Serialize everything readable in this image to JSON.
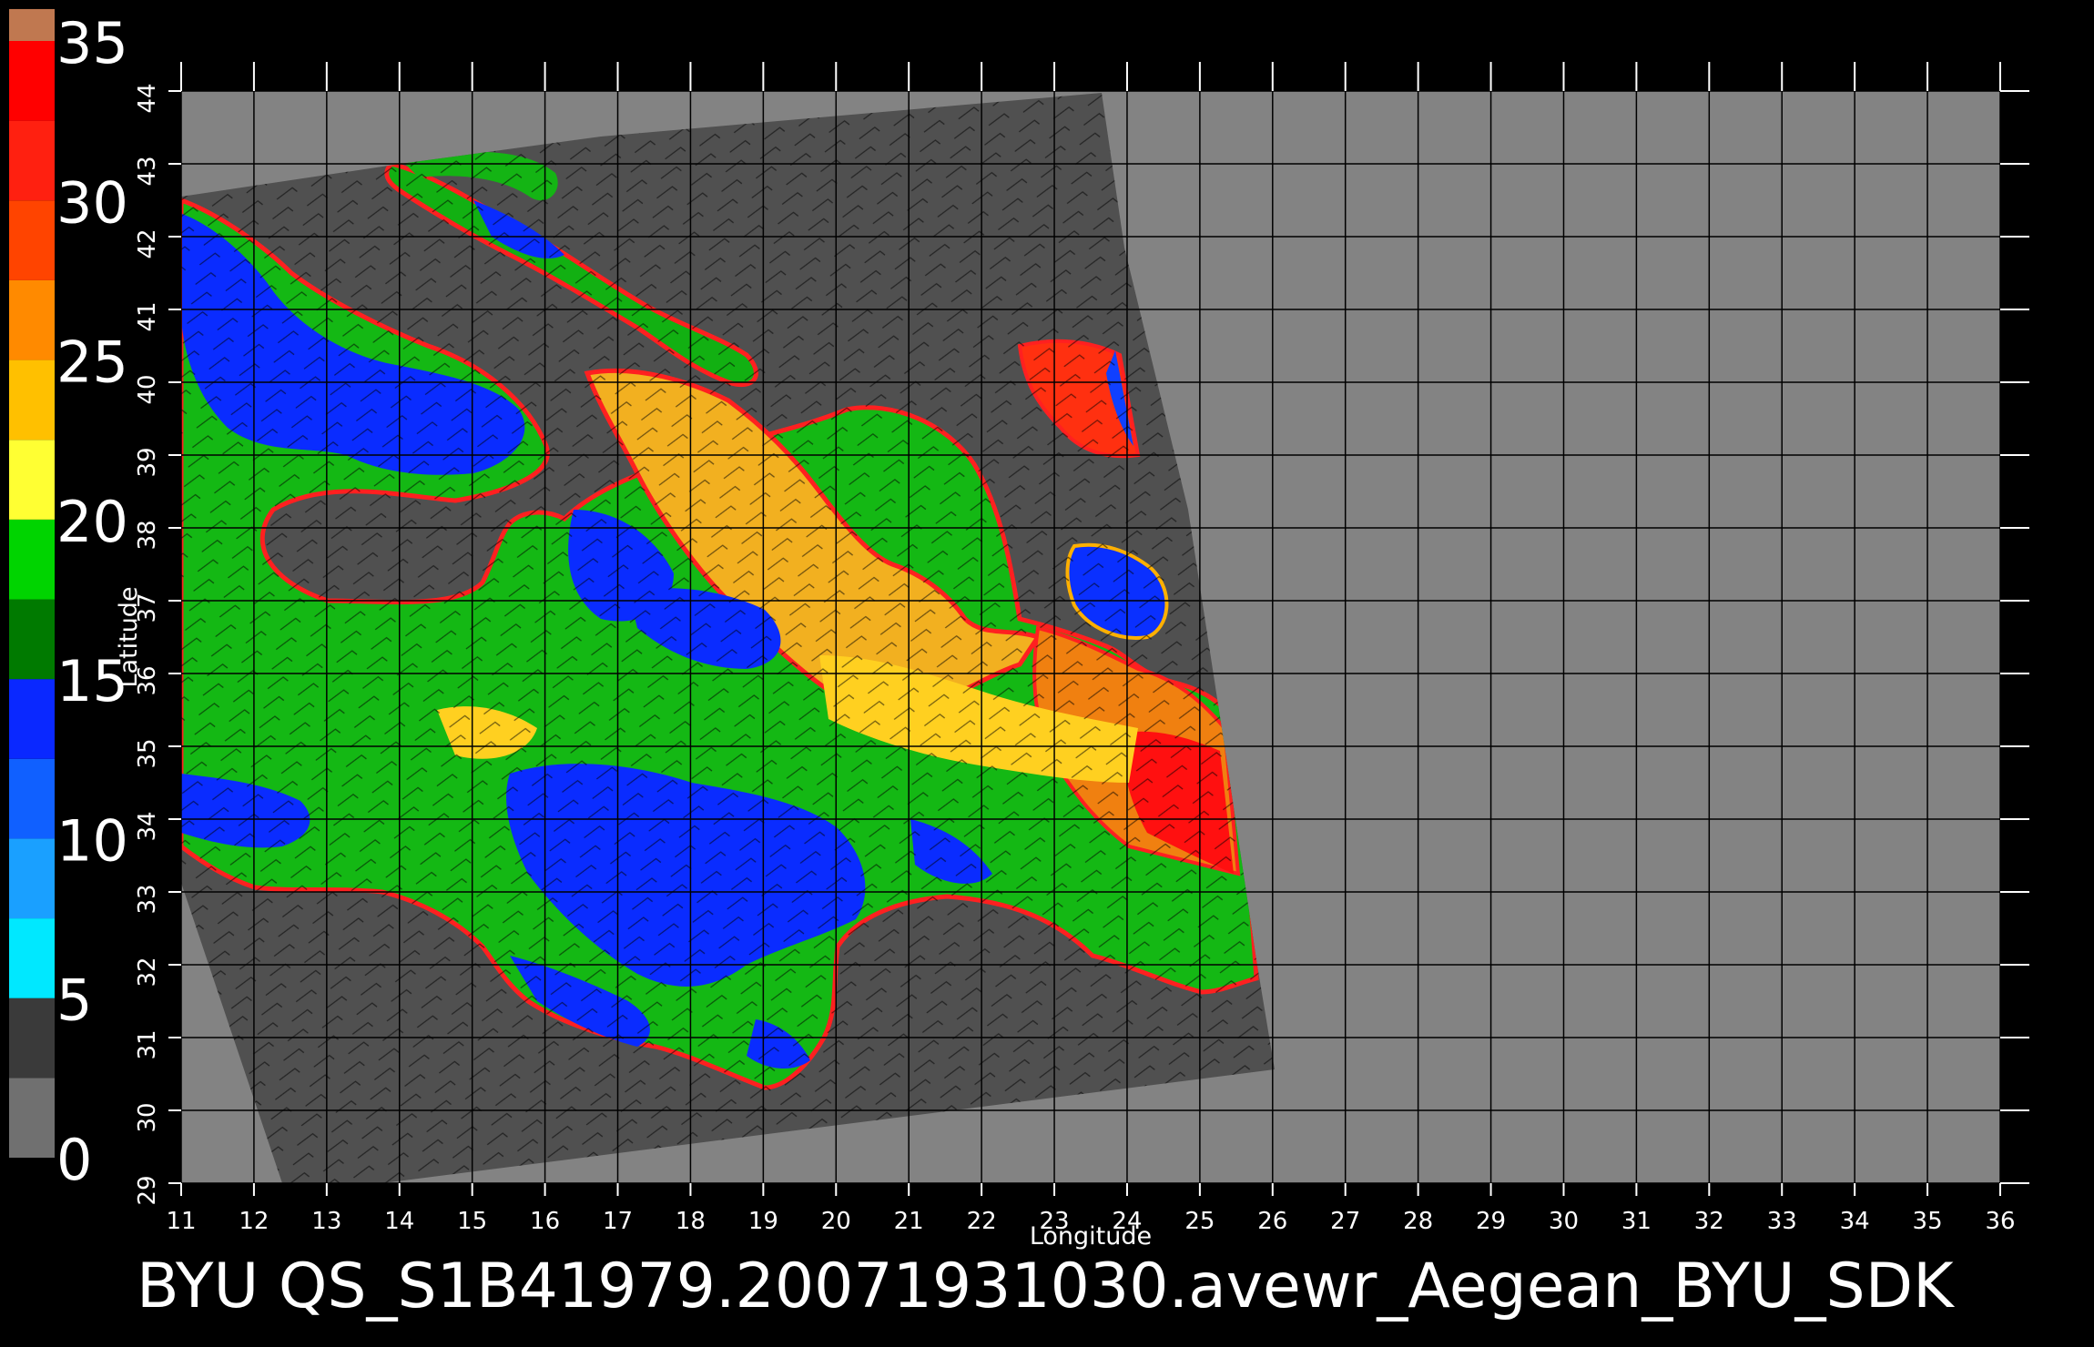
{
  "title": "BYU  QS_S1B41979.20071931030.avewr_Aegean_BYU_SDK",
  "axes": {
    "xlabel": "Longitude",
    "ylabel": "Latitude",
    "x_range": [
      11,
      36
    ],
    "y_range": [
      29,
      44
    ],
    "x_ticks": [
      "11",
      "12",
      "13",
      "14",
      "15",
      "16",
      "17",
      "18",
      "19",
      "20",
      "21",
      "22",
      "23",
      "24",
      "25",
      "26",
      "27",
      "28",
      "29",
      "30",
      "31",
      "32",
      "33",
      "34",
      "35",
      "36"
    ],
    "y_ticks": [
      "29",
      "30",
      "31",
      "32",
      "33",
      "34",
      "35",
      "36",
      "37",
      "38",
      "39",
      "40",
      "41",
      "42",
      "43",
      "44"
    ],
    "grid": true
  },
  "colorbar": {
    "range": [
      0,
      35
    ],
    "labels": [
      "35",
      "30",
      "25",
      "20",
      "15",
      "10",
      "5",
      "0"
    ],
    "label_values": [
      35,
      30,
      25,
      20,
      15,
      10,
      5,
      0
    ],
    "bands": [
      {
        "from": 0,
        "to": 2.5,
        "color": "#707070"
      },
      {
        "from": 2.5,
        "to": 5,
        "color": "#3a3a3a"
      },
      {
        "from": 5,
        "to": 7.5,
        "color": "#00e8ff"
      },
      {
        "from": 7.5,
        "to": 10,
        "color": "#1aa0ff"
      },
      {
        "from": 10,
        "to": 12.5,
        "color": "#1060ff"
      },
      {
        "from": 12.5,
        "to": 15,
        "color": "#0a28ff"
      },
      {
        "from": 15,
        "to": 17.5,
        "color": "#007a00"
      },
      {
        "from": 17.5,
        "to": 20,
        "color": "#00d400"
      },
      {
        "from": 20,
        "to": 22.5,
        "color": "#ffff33"
      },
      {
        "from": 22.5,
        "to": 25,
        "color": "#ffc000"
      },
      {
        "from": 25,
        "to": 27.5,
        "color": "#ff8a00"
      },
      {
        "from": 27.5,
        "to": 30,
        "color": "#ff4400"
      },
      {
        "from": 30,
        "to": 32.5,
        "color": "#ff2010"
      },
      {
        "from": 32.5,
        "to": 35,
        "color": "#ff0000"
      },
      {
        "from": 35,
        "to": 36,
        "color": "#c07850"
      }
    ]
  },
  "colors": {
    "background": "#000000",
    "outside_swath": "#838383",
    "swath_land": "#505050",
    "grid": "#000000"
  }
}
